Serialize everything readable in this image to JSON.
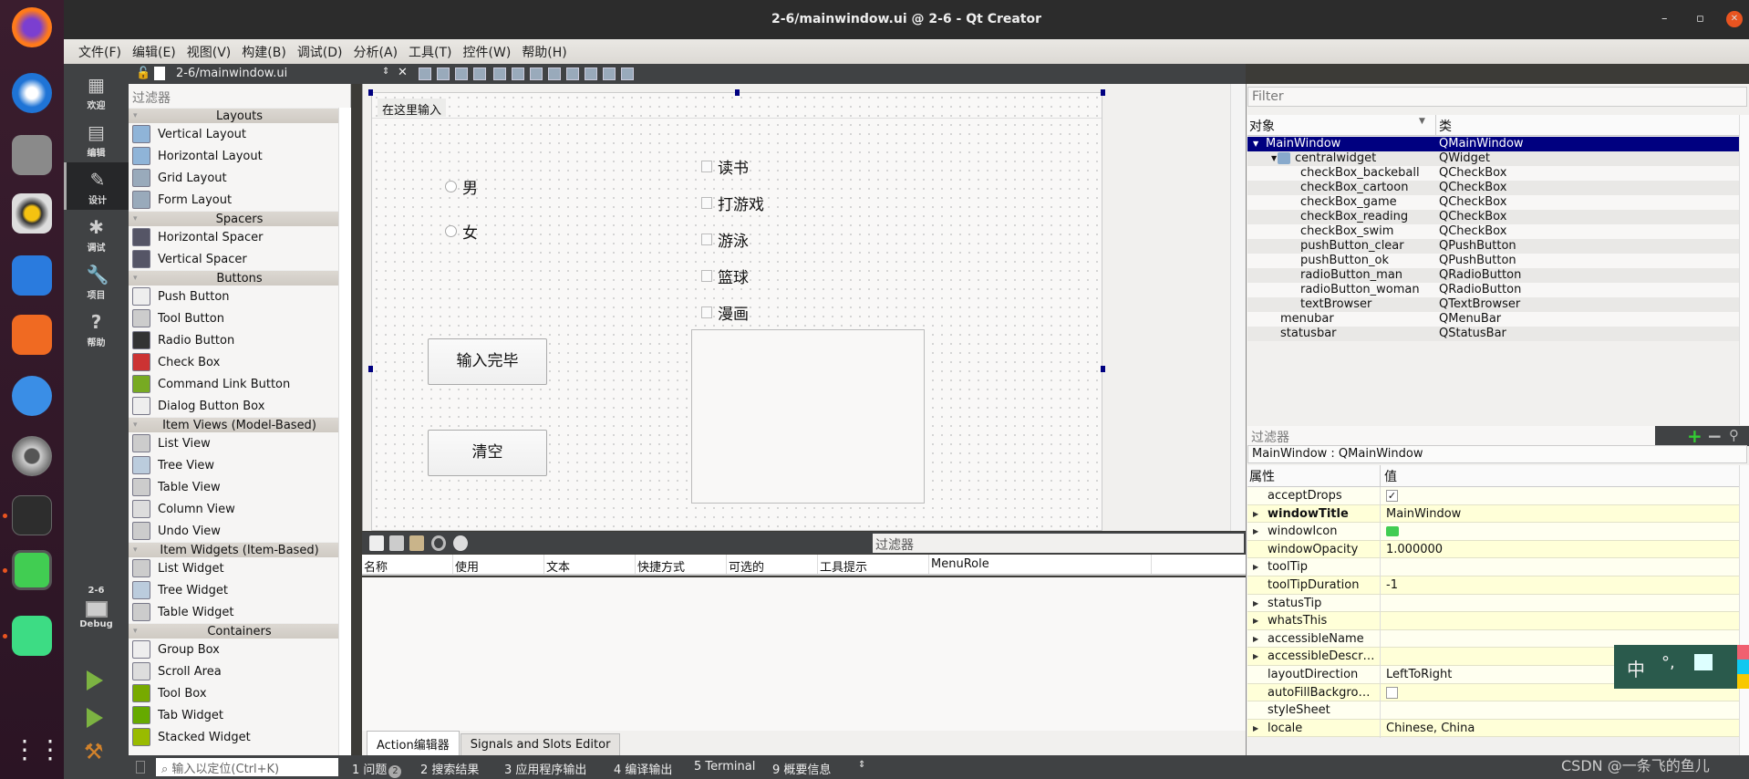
{
  "window": {
    "title": "2-6/mainwindow.ui @ 2-6 - Qt Creator",
    "minimize": "–",
    "maximize": "▫",
    "close": "✕"
  },
  "menu": [
    "文件(F)",
    "编辑(E)",
    "视图(V)",
    "构建(B)",
    "调试(D)",
    "分析(A)",
    "工具(T)",
    "控件(W)",
    "帮助(H)"
  ],
  "modes": [
    {
      "label": "欢迎",
      "icon": "grid-icon",
      "glyph": "▦"
    },
    {
      "label": "编辑",
      "icon": "document-icon",
      "glyph": "▤"
    },
    {
      "label": "设计",
      "icon": "pencil-icon",
      "glyph": "✎",
      "active": true
    },
    {
      "label": "调试",
      "icon": "bug-icon",
      "glyph": "✱"
    },
    {
      "label": "项目",
      "icon": "wrench-icon",
      "glyph": "🔧"
    },
    {
      "label": "帮助",
      "icon": "help-icon",
      "glyph": "?"
    }
  ],
  "kit": {
    "project": "2-6",
    "config": "Debug"
  },
  "editor": {
    "file": "2-6/mainwindow.ui"
  },
  "widgetbox": {
    "filter_placeholder": "过滤器",
    "sections": [
      {
        "title": "Layouts",
        "items": [
          "Vertical Layout",
          "Horizontal Layout",
          "Grid Layout",
          "Form Layout"
        ]
      },
      {
        "title": "Spacers",
        "items": [
          "Horizontal Spacer",
          "Vertical Spacer"
        ]
      },
      {
        "title": "Buttons",
        "items": [
          "Push Button",
          "Tool Button",
          "Radio Button",
          "Check Box",
          "Command Link Button",
          "Dialog Button Box"
        ]
      },
      {
        "title": "Item Views (Model-Based)",
        "items": [
          "List View",
          "Tree View",
          "Table View",
          "Column View",
          "Undo View"
        ]
      },
      {
        "title": "Item Widgets (Item-Based)",
        "items": [
          "List Widget",
          "Tree Widget",
          "Table Widget"
        ]
      },
      {
        "title": "Containers",
        "items": [
          "Group Box",
          "Scroll Area",
          "Tool Box",
          "Tab Widget",
          "Stacked Widget"
        ]
      }
    ]
  },
  "form": {
    "menu_placeholder": "在这里输入",
    "radios": [
      "男",
      "女"
    ],
    "checkboxes": [
      "读书",
      "打游戏",
      "游泳",
      "篮球",
      "漫画"
    ],
    "buttons": [
      "输入完毕",
      "清空"
    ]
  },
  "action_editor": {
    "filter_placeholder": "过滤器",
    "columns": [
      "名称",
      "使用",
      "文本",
      "快捷方式",
      "可选的",
      "工具提示",
      "MenuRole"
    ],
    "tabs": [
      "Action编辑器",
      "Signals and Slots Editor"
    ]
  },
  "object_inspector": {
    "filter_placeholder": "Filter",
    "columns": [
      "对象",
      "类"
    ],
    "rows": [
      {
        "name": "MainWindow",
        "class": "QMainWindow",
        "level": 0,
        "selected": true
      },
      {
        "name": "centralwidget",
        "class": "QWidget",
        "level": 1
      },
      {
        "name": "checkBox_backeball",
        "class": "QCheckBox",
        "level": 2
      },
      {
        "name": "checkBox_cartoon",
        "class": "QCheckBox",
        "level": 2
      },
      {
        "name": "checkBox_game",
        "class": "QCheckBox",
        "level": 2
      },
      {
        "name": "checkBox_reading",
        "class": "QCheckBox",
        "level": 2
      },
      {
        "name": "checkBox_swim",
        "class": "QCheckBox",
        "level": 2
      },
      {
        "name": "pushButton_clear",
        "class": "QPushButton",
        "level": 2
      },
      {
        "name": "pushButton_ok",
        "class": "QPushButton",
        "level": 2
      },
      {
        "name": "radioButton_man",
        "class": "QRadioButton",
        "level": 2
      },
      {
        "name": "radioButton_woman",
        "class": "QRadioButton",
        "level": 2
      },
      {
        "name": "textBrowser",
        "class": "QTextBrowser",
        "level": 2
      },
      {
        "name": "menubar",
        "class": "QMenuBar",
        "level": 1
      },
      {
        "name": "statusbar",
        "class": "QStatusBar",
        "level": 1
      }
    ]
  },
  "property_editor": {
    "filter_placeholder": "过滤器",
    "object": "MainWindow : QMainWindow",
    "columns": [
      "属性",
      "值"
    ],
    "rows": [
      {
        "name": "acceptDrops",
        "value": "",
        "checkbox": true,
        "checked": true
      },
      {
        "name": "windowTitle",
        "value": "MainWindow",
        "expand": true,
        "bold": true
      },
      {
        "name": "windowIcon",
        "value": "",
        "expand": true,
        "icon": "qt-icon"
      },
      {
        "name": "windowOpacity",
        "value": "1.000000"
      },
      {
        "name": "toolTip",
        "value": "",
        "expand": true
      },
      {
        "name": "toolTipDuration",
        "value": "-1"
      },
      {
        "name": "statusTip",
        "value": "",
        "expand": true
      },
      {
        "name": "whatsThis",
        "value": "",
        "expand": true
      },
      {
        "name": "accessibleName",
        "value": "",
        "expand": true
      },
      {
        "name": "accessibleDescr…",
        "value": "",
        "expand": true
      },
      {
        "name": "layoutDirection",
        "value": "LeftToRight"
      },
      {
        "name": "autoFillBackgro…",
        "value": "",
        "checkbox": true,
        "checked": false
      },
      {
        "name": "styleSheet",
        "value": ""
      },
      {
        "name": "locale",
        "value": "Chinese, China",
        "expand": true
      }
    ]
  },
  "ime": {
    "mode": "中",
    "punct": "°,",
    "skin": "shirt-icon"
  },
  "statusbar": {
    "locate_placeholder": "输入以定位(Ctrl+K)",
    "tabs": [
      "1 问题",
      "2 搜索结果",
      "3 应用程序输出",
      "4 编译输出",
      "5 Terminal",
      "9 概要信息"
    ],
    "issues_badge": "2"
  },
  "watermark": "CSDN @一条飞的鱼儿",
  "colors": {
    "selection": "#000080",
    "property_bg": "#ffffd8",
    "sidebar": "#404244",
    "accent": "#e95420"
  }
}
